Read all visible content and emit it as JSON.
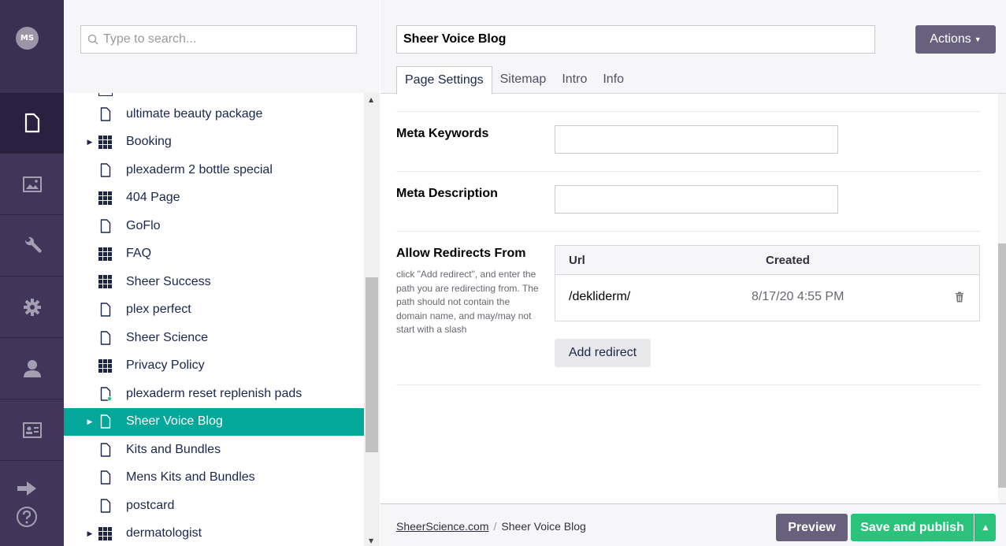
{
  "user": {
    "initials": "MS"
  },
  "rail": {
    "sections": [
      {
        "name": "content-section",
        "icon": "document-icon"
      },
      {
        "name": "media-section",
        "icon": "image-icon"
      },
      {
        "name": "settings-section",
        "icon": "wrench-icon"
      },
      {
        "name": "packages-section",
        "icon": "gear-icon"
      },
      {
        "name": "users-section",
        "icon": "user-icon"
      },
      {
        "name": "members-section",
        "icon": "id-card-icon"
      }
    ],
    "bottom": [
      "arrow-right-icon",
      "help-icon"
    ]
  },
  "tree": {
    "search_placeholder": "Type to search...",
    "items": [
      {
        "label": "ultimate beauty package",
        "icon": "page-icon",
        "expandable": false,
        "selected": false
      },
      {
        "label": "Booking",
        "icon": "grid-icon",
        "expandable": true,
        "selected": false
      },
      {
        "label": "plexaderm 2 bottle special",
        "icon": "page-icon",
        "expandable": false,
        "selected": false
      },
      {
        "label": "404 Page",
        "icon": "grid-icon",
        "expandable": false,
        "selected": false
      },
      {
        "label": "GoFlo",
        "icon": "page-icon",
        "expandable": false,
        "selected": false
      },
      {
        "label": "FAQ",
        "icon": "grid-icon",
        "expandable": false,
        "selected": false
      },
      {
        "label": "Sheer Success",
        "icon": "grid-icon",
        "expandable": false,
        "selected": false
      },
      {
        "label": "plex perfect",
        "icon": "page-icon",
        "expandable": false,
        "selected": false
      },
      {
        "label": "Sheer Science",
        "icon": "page-icon",
        "expandable": false,
        "selected": false
      },
      {
        "label": "Privacy Policy",
        "icon": "grid-icon",
        "expandable": false,
        "selected": false
      },
      {
        "label": "plexaderm reset replenish pads",
        "icon": "page-new-icon",
        "expandable": false,
        "selected": false
      },
      {
        "label": "Sheer Voice Blog",
        "icon": "page-icon",
        "expandable": true,
        "selected": true
      },
      {
        "label": "Kits and Bundles",
        "icon": "page-icon",
        "expandable": false,
        "selected": false
      },
      {
        "label": "Mens Kits and Bundles",
        "icon": "page-icon",
        "expandable": false,
        "selected": false
      },
      {
        "label": "postcard",
        "icon": "page-icon",
        "expandable": false,
        "selected": false
      },
      {
        "label": "dermatologist",
        "icon": "grid-icon",
        "expandable": true,
        "selected": false
      }
    ]
  },
  "editor": {
    "page_name": "Sheer Voice Blog",
    "actions_label": "Actions",
    "tabs": [
      {
        "label": "Page Settings",
        "active": true
      },
      {
        "label": "Sitemap",
        "active": false
      },
      {
        "label": "Intro",
        "active": false
      },
      {
        "label": "Info",
        "active": false
      }
    ],
    "meta_keywords": {
      "label": "Meta Keywords",
      "value": ""
    },
    "meta_description": {
      "label": "Meta Description",
      "value": ""
    },
    "redirects": {
      "label": "Allow Redirects From",
      "description": "click \"Add redirect\", and enter the path you are redirecting from. The path should not contain the domain name, and may/may not start with a slash",
      "headers": {
        "url": "Url",
        "created": "Created"
      },
      "rows": [
        {
          "url": "/dekliderm/",
          "created": "8/17/20 4:55 PM"
        }
      ],
      "add_label": "Add redirect"
    }
  },
  "footer": {
    "breadcrumb": {
      "root": "SheerScience.com",
      "separator": "/",
      "current": "Sheer Voice Blog"
    },
    "preview_label": "Preview",
    "publish_label": "Save and publish"
  },
  "colors": {
    "rail_bg": "#413659",
    "selected_row": "#03a89b",
    "publish_green": "#2bc37c",
    "button_purple": "#68617e"
  }
}
